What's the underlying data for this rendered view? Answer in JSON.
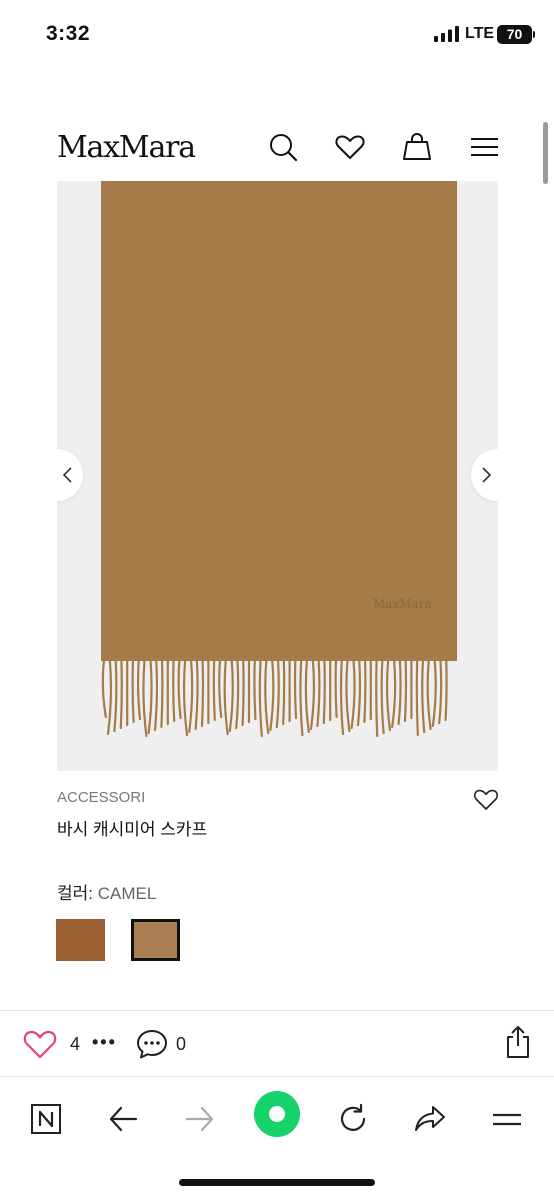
{
  "status_bar": {
    "time": "3:32",
    "network": "LTE",
    "battery": "70"
  },
  "header": {
    "logo": "MaxMara",
    "icons": [
      "search-icon",
      "heart-icon",
      "bag-icon",
      "menu-icon"
    ]
  },
  "product_image": {
    "scarf_color": "#a57b4a",
    "scarf_brand_mark": "MaxMara",
    "prev_icon": "chevron-left-icon",
    "next_icon": "chevron-right-icon"
  },
  "product": {
    "category": "ACCESSORI",
    "title": "바시 캐시미어 스카프",
    "color_label": "컬러: ",
    "color_value": "CAMEL",
    "swatches": [
      {
        "name": "brown",
        "color": "#9b5e33",
        "selected": false
      },
      {
        "name": "camel",
        "color": "#a87e52",
        "selected": true
      }
    ]
  },
  "social": {
    "like_count": "4",
    "more": "•••",
    "comment_count": "0",
    "accent": "#e0457b"
  },
  "toolbar": {
    "icons": [
      "naver-icon",
      "back-icon",
      "forward-icon",
      "home-icon",
      "reload-icon",
      "share-icon",
      "menu-icon"
    ],
    "home_color": "#16d26b"
  }
}
